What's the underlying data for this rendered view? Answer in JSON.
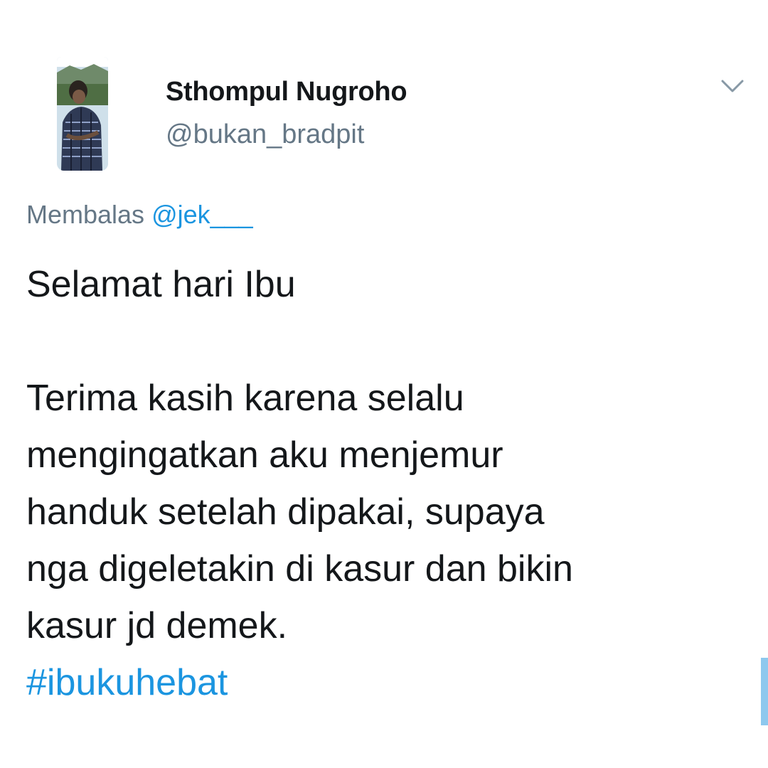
{
  "tweet": {
    "author_name": "Sthompul Nugroho",
    "author_handle": "@bukan_bradpit",
    "avatar_icon": "profile-photo",
    "menu_icon": "chevron-down-icon",
    "reply_prefix": "Membalas",
    "reply_mention": "@jek___",
    "body_lines_1": [
      "Selamat hari Ibu"
    ],
    "body_lines_2": [
      "Terima kasih karena selalu",
      "mengingatkan aku menjemur",
      "handuk setelah dipakai, supaya",
      "nga digeletakin di kasur dan bikin",
      "kasur jd demek."
    ],
    "hashtag": "#ibukuhebat"
  },
  "colors": {
    "text": "#14171a",
    "secondary_text": "#657786",
    "link": "#1b95e0",
    "background": "#ffffff"
  }
}
